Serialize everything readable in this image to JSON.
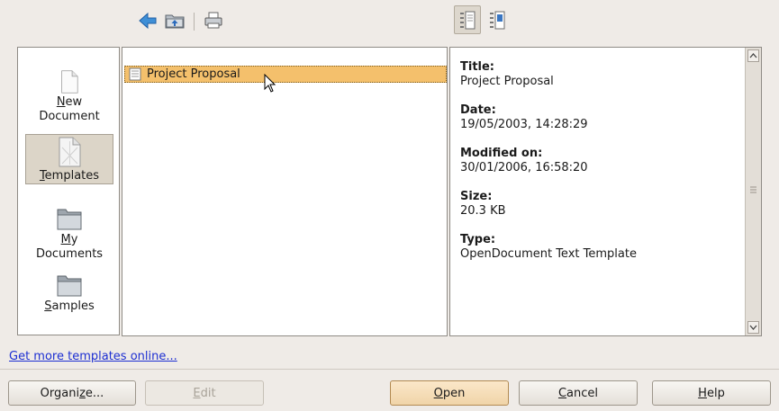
{
  "toolbar": {
    "back_icon": "arrow-left-icon",
    "up_icon": "folder-up-icon",
    "print_icon": "printer-icon",
    "view_list_icon": "list-view-icon",
    "view_detail_icon": "detail-view-icon"
  },
  "categories": [
    {
      "mnemonic": "N",
      "line1_rest": "ew",
      "line2": "Document",
      "icon": "new-document-icon"
    },
    {
      "mnemonic": "T",
      "line1_rest": "emplates",
      "line2": "",
      "icon": "templates-icon"
    },
    {
      "mnemonic": "M",
      "line1_rest": "y",
      "line2": "Documents",
      "icon": "folder-icon"
    },
    {
      "mnemonic": "S",
      "line1_rest": "amples",
      "line2": "",
      "icon": "folder-icon"
    }
  ],
  "selected_category": "Templates",
  "files": [
    {
      "name": "Project Proposal",
      "selected": true
    }
  ],
  "info": {
    "title_label": "Title:",
    "title_value": "Project Proposal",
    "date_label": "Date:",
    "date_value": "19/05/2003, 14:28:29",
    "modified_label": "Modified on:",
    "modified_value": "30/01/2006, 16:58:20",
    "size_label": "Size:",
    "size_value": "20.3 KB",
    "type_label": "Type:",
    "type_value": "OpenDocument Text Template"
  },
  "link_text": "Get more templates online...",
  "buttons": {
    "organize": {
      "pre": "Organi",
      "mnemonic": "z",
      "post": "e..."
    },
    "edit": {
      "pre": "",
      "mnemonic": "E",
      "post": "dit"
    },
    "open": {
      "pre": "",
      "mnemonic": "O",
      "post": "pen"
    },
    "cancel": {
      "pre": "",
      "mnemonic": "C",
      "post": "ancel"
    },
    "help": {
      "pre": "",
      "mnemonic": "H",
      "post": "elp"
    }
  },
  "colors": {
    "accent_selection": "#f4c06c",
    "link": "#1d2fd2"
  }
}
